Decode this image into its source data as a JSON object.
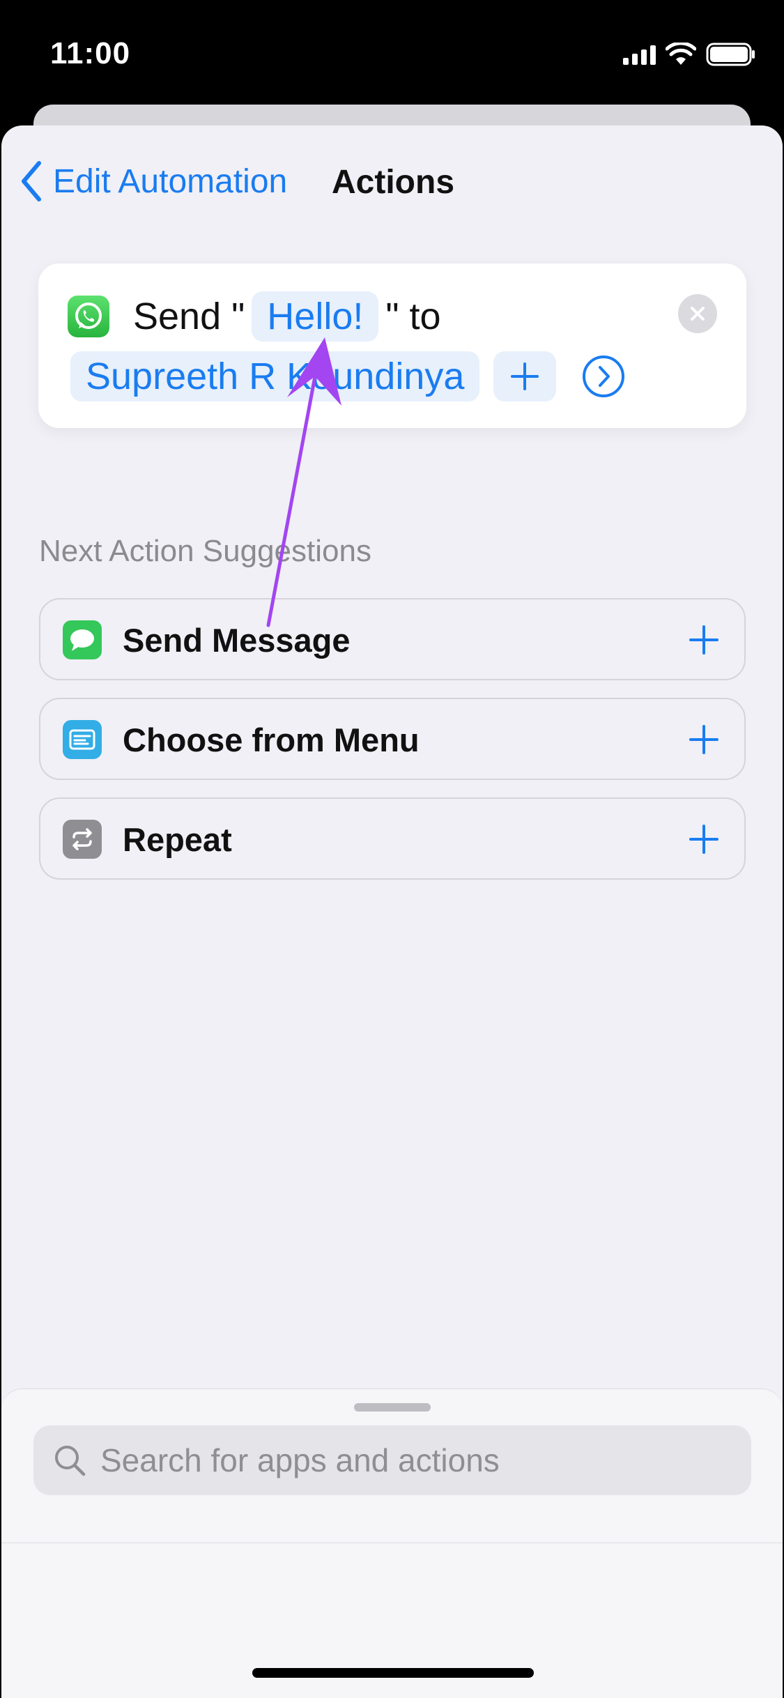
{
  "status_bar": {
    "time": "11:00"
  },
  "nav": {
    "back_label": "Edit Automation",
    "title": "Actions"
  },
  "action": {
    "prefix": "Send \"",
    "message": "Hello!",
    "suffix": "\" to",
    "recipient": "Supreeth R Koundinya",
    "app_icon": "whatsapp-icon"
  },
  "suggestions": {
    "header": "Next Action Suggestions",
    "items": [
      {
        "label": "Send Message",
        "icon": "messages-icon",
        "color": "#34c759"
      },
      {
        "label": "Choose from Menu",
        "icon": "menu-icon",
        "color": "#32ade6"
      },
      {
        "label": "Repeat",
        "icon": "repeat-icon",
        "color": "#8e8e93"
      }
    ]
  },
  "search": {
    "placeholder": "Search for apps and actions"
  },
  "colors": {
    "accent": "#1a7cf0",
    "annotation": "#a345f0"
  }
}
